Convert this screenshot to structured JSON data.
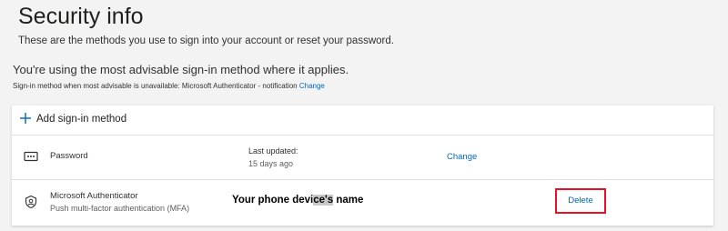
{
  "header": {
    "title": "Security info",
    "description": "These are the methods you use to sign into your account or reset your password."
  },
  "advice": {
    "text": "You're using the most advisable sign-in method where it applies.",
    "default_method_text": "Sign-in method when most advisable is unavailable: Microsoft Authenticator - notification",
    "default_method_change": "Change"
  },
  "methods": {
    "add_label": "Add sign-in method",
    "password": {
      "name": "Password",
      "last_updated_label": "Last updated:",
      "last_updated_value": "15 days ago",
      "action": "Change",
      "icon": "password-icon"
    },
    "authenticator": {
      "name": "Microsoft Authenticator",
      "detail": "Push multi-factor authentication (MFA)",
      "device_name_part1": "Your phone devi",
      "device_name_part2": "ce's",
      "device_name_part3": " name",
      "action": "Delete",
      "icon": "authenticator-icon"
    }
  },
  "colors": {
    "accent": "#0067b8",
    "highlight_border": "#e81123",
    "background": "#f3f3f3"
  }
}
